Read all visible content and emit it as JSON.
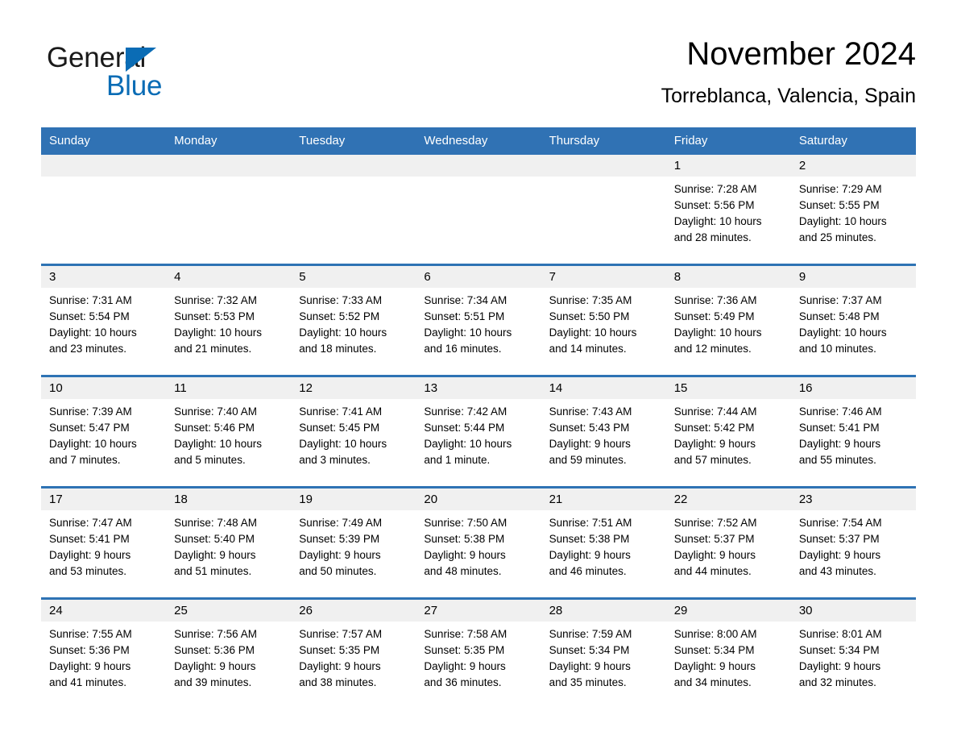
{
  "logo": {
    "text_primary": "General",
    "text_secondary": "Blue",
    "triangle_color": "#0a6cb5"
  },
  "header": {
    "title": "November 2024",
    "location": "Torreblanca, Valencia, Spain"
  },
  "theme": {
    "header_blue": "#3072b4",
    "row_separator_blue": "#2e73b4",
    "daynum_band_gray": "#f0f0f0",
    "text_color": "#000000"
  },
  "weekdays": [
    "Sunday",
    "Monday",
    "Tuesday",
    "Wednesday",
    "Thursday",
    "Friday",
    "Saturday"
  ],
  "weeks": [
    [
      {
        "day": "",
        "sunrise": "",
        "sunset": "",
        "daylight_line1": "",
        "daylight_line2": "",
        "empty": true
      },
      {
        "day": "",
        "sunrise": "",
        "sunset": "",
        "daylight_line1": "",
        "daylight_line2": "",
        "empty": true
      },
      {
        "day": "",
        "sunrise": "",
        "sunset": "",
        "daylight_line1": "",
        "daylight_line2": "",
        "empty": true
      },
      {
        "day": "",
        "sunrise": "",
        "sunset": "",
        "daylight_line1": "",
        "daylight_line2": "",
        "empty": true
      },
      {
        "day": "",
        "sunrise": "",
        "sunset": "",
        "daylight_line1": "",
        "daylight_line2": "",
        "empty": true
      },
      {
        "day": "1",
        "sunrise": "Sunrise: 7:28 AM",
        "sunset": "Sunset: 5:56 PM",
        "daylight_line1": "Daylight: 10 hours",
        "daylight_line2": "and 28 minutes.",
        "empty": false
      },
      {
        "day": "2",
        "sunrise": "Sunrise: 7:29 AM",
        "sunset": "Sunset: 5:55 PM",
        "daylight_line1": "Daylight: 10 hours",
        "daylight_line2": "and 25 minutes.",
        "empty": false
      }
    ],
    [
      {
        "day": "3",
        "sunrise": "Sunrise: 7:31 AM",
        "sunset": "Sunset: 5:54 PM",
        "daylight_line1": "Daylight: 10 hours",
        "daylight_line2": "and 23 minutes.",
        "empty": false
      },
      {
        "day": "4",
        "sunrise": "Sunrise: 7:32 AM",
        "sunset": "Sunset: 5:53 PM",
        "daylight_line1": "Daylight: 10 hours",
        "daylight_line2": "and 21 minutes.",
        "empty": false
      },
      {
        "day": "5",
        "sunrise": "Sunrise: 7:33 AM",
        "sunset": "Sunset: 5:52 PM",
        "daylight_line1": "Daylight: 10 hours",
        "daylight_line2": "and 18 minutes.",
        "empty": false
      },
      {
        "day": "6",
        "sunrise": "Sunrise: 7:34 AM",
        "sunset": "Sunset: 5:51 PM",
        "daylight_line1": "Daylight: 10 hours",
        "daylight_line2": "and 16 minutes.",
        "empty": false
      },
      {
        "day": "7",
        "sunrise": "Sunrise: 7:35 AM",
        "sunset": "Sunset: 5:50 PM",
        "daylight_line1": "Daylight: 10 hours",
        "daylight_line2": "and 14 minutes.",
        "empty": false
      },
      {
        "day": "8",
        "sunrise": "Sunrise: 7:36 AM",
        "sunset": "Sunset: 5:49 PM",
        "daylight_line1": "Daylight: 10 hours",
        "daylight_line2": "and 12 minutes.",
        "empty": false
      },
      {
        "day": "9",
        "sunrise": "Sunrise: 7:37 AM",
        "sunset": "Sunset: 5:48 PM",
        "daylight_line1": "Daylight: 10 hours",
        "daylight_line2": "and 10 minutes.",
        "empty": false
      }
    ],
    [
      {
        "day": "10",
        "sunrise": "Sunrise: 7:39 AM",
        "sunset": "Sunset: 5:47 PM",
        "daylight_line1": "Daylight: 10 hours",
        "daylight_line2": "and 7 minutes.",
        "empty": false
      },
      {
        "day": "11",
        "sunrise": "Sunrise: 7:40 AM",
        "sunset": "Sunset: 5:46 PM",
        "daylight_line1": "Daylight: 10 hours",
        "daylight_line2": "and 5 minutes.",
        "empty": false
      },
      {
        "day": "12",
        "sunrise": "Sunrise: 7:41 AM",
        "sunset": "Sunset: 5:45 PM",
        "daylight_line1": "Daylight: 10 hours",
        "daylight_line2": "and 3 minutes.",
        "empty": false
      },
      {
        "day": "13",
        "sunrise": "Sunrise: 7:42 AM",
        "sunset": "Sunset: 5:44 PM",
        "daylight_line1": "Daylight: 10 hours",
        "daylight_line2": "and 1 minute.",
        "empty": false
      },
      {
        "day": "14",
        "sunrise": "Sunrise: 7:43 AM",
        "sunset": "Sunset: 5:43 PM",
        "daylight_line1": "Daylight: 9 hours",
        "daylight_line2": "and 59 minutes.",
        "empty": false
      },
      {
        "day": "15",
        "sunrise": "Sunrise: 7:44 AM",
        "sunset": "Sunset: 5:42 PM",
        "daylight_line1": "Daylight: 9 hours",
        "daylight_line2": "and 57 minutes.",
        "empty": false
      },
      {
        "day": "16",
        "sunrise": "Sunrise: 7:46 AM",
        "sunset": "Sunset: 5:41 PM",
        "daylight_line1": "Daylight: 9 hours",
        "daylight_line2": "and 55 minutes.",
        "empty": false
      }
    ],
    [
      {
        "day": "17",
        "sunrise": "Sunrise: 7:47 AM",
        "sunset": "Sunset: 5:41 PM",
        "daylight_line1": "Daylight: 9 hours",
        "daylight_line2": "and 53 minutes.",
        "empty": false
      },
      {
        "day": "18",
        "sunrise": "Sunrise: 7:48 AM",
        "sunset": "Sunset: 5:40 PM",
        "daylight_line1": "Daylight: 9 hours",
        "daylight_line2": "and 51 minutes.",
        "empty": false
      },
      {
        "day": "19",
        "sunrise": "Sunrise: 7:49 AM",
        "sunset": "Sunset: 5:39 PM",
        "daylight_line1": "Daylight: 9 hours",
        "daylight_line2": "and 50 minutes.",
        "empty": false
      },
      {
        "day": "20",
        "sunrise": "Sunrise: 7:50 AM",
        "sunset": "Sunset: 5:38 PM",
        "daylight_line1": "Daylight: 9 hours",
        "daylight_line2": "and 48 minutes.",
        "empty": false
      },
      {
        "day": "21",
        "sunrise": "Sunrise: 7:51 AM",
        "sunset": "Sunset: 5:38 PM",
        "daylight_line1": "Daylight: 9 hours",
        "daylight_line2": "and 46 minutes.",
        "empty": false
      },
      {
        "day": "22",
        "sunrise": "Sunrise: 7:52 AM",
        "sunset": "Sunset: 5:37 PM",
        "daylight_line1": "Daylight: 9 hours",
        "daylight_line2": "and 44 minutes.",
        "empty": false
      },
      {
        "day": "23",
        "sunrise": "Sunrise: 7:54 AM",
        "sunset": "Sunset: 5:37 PM",
        "daylight_line1": "Daylight: 9 hours",
        "daylight_line2": "and 43 minutes.",
        "empty": false
      }
    ],
    [
      {
        "day": "24",
        "sunrise": "Sunrise: 7:55 AM",
        "sunset": "Sunset: 5:36 PM",
        "daylight_line1": "Daylight: 9 hours",
        "daylight_line2": "and 41 minutes.",
        "empty": false
      },
      {
        "day": "25",
        "sunrise": "Sunrise: 7:56 AM",
        "sunset": "Sunset: 5:36 PM",
        "daylight_line1": "Daylight: 9 hours",
        "daylight_line2": "and 39 minutes.",
        "empty": false
      },
      {
        "day": "26",
        "sunrise": "Sunrise: 7:57 AM",
        "sunset": "Sunset: 5:35 PM",
        "daylight_line1": "Daylight: 9 hours",
        "daylight_line2": "and 38 minutes.",
        "empty": false
      },
      {
        "day": "27",
        "sunrise": "Sunrise: 7:58 AM",
        "sunset": "Sunset: 5:35 PM",
        "daylight_line1": "Daylight: 9 hours",
        "daylight_line2": "and 36 minutes.",
        "empty": false
      },
      {
        "day": "28",
        "sunrise": "Sunrise: 7:59 AM",
        "sunset": "Sunset: 5:34 PM",
        "daylight_line1": "Daylight: 9 hours",
        "daylight_line2": "and 35 minutes.",
        "empty": false
      },
      {
        "day": "29",
        "sunrise": "Sunrise: 8:00 AM",
        "sunset": "Sunset: 5:34 PM",
        "daylight_line1": "Daylight: 9 hours",
        "daylight_line2": "and 34 minutes.",
        "empty": false
      },
      {
        "day": "30",
        "sunrise": "Sunrise: 8:01 AM",
        "sunset": "Sunset: 5:34 PM",
        "daylight_line1": "Daylight: 9 hours",
        "daylight_line2": "and 32 minutes.",
        "empty": false
      }
    ]
  ]
}
